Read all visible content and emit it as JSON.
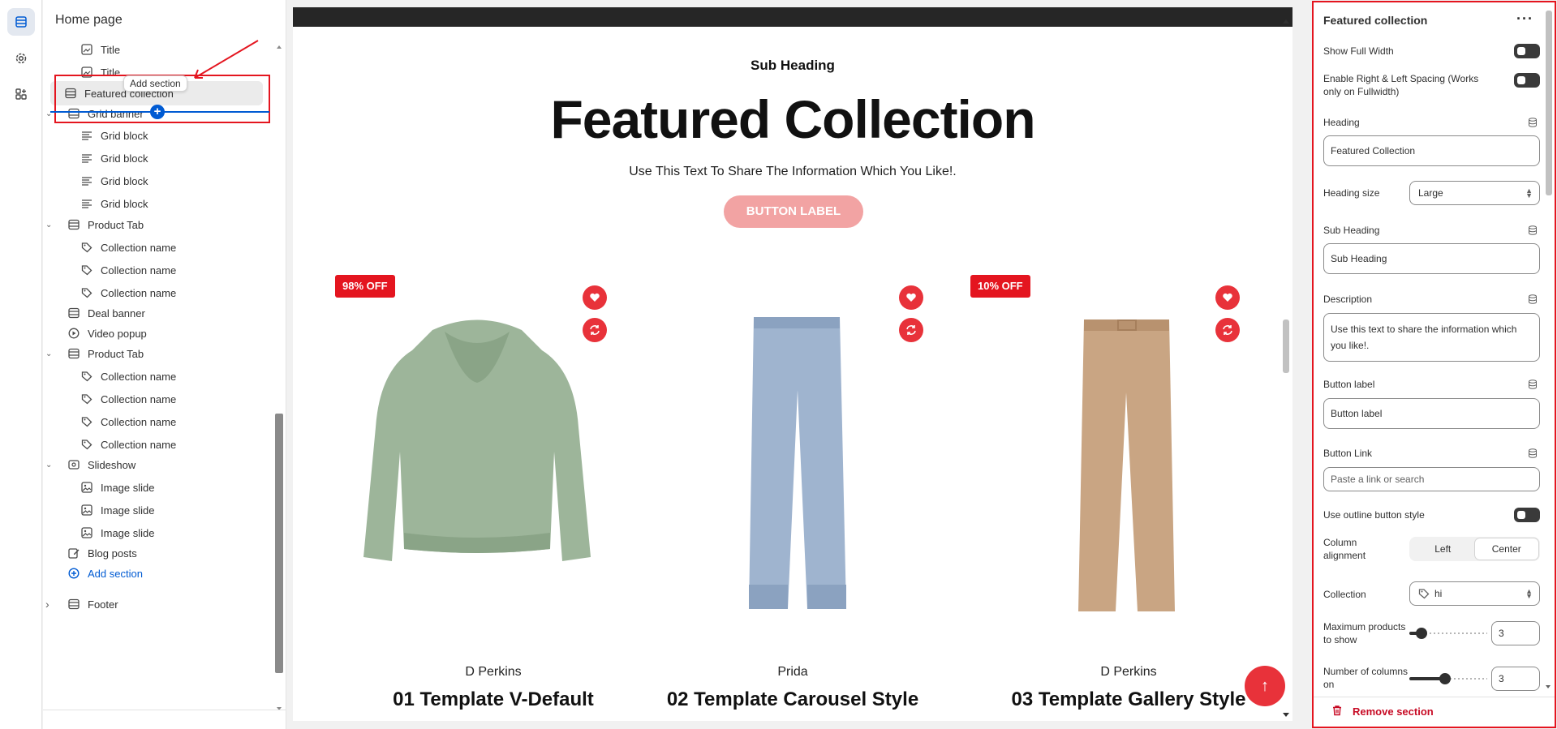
{
  "rail": {
    "items": [
      {
        "icon": "sections-icon",
        "active": true
      },
      {
        "icon": "gear-icon",
        "active": false
      },
      {
        "icon": "apps-icon",
        "active": false
      }
    ]
  },
  "sidebar": {
    "title": "Home page",
    "tooltip": "Add section",
    "nodes": [
      {
        "label": "Title",
        "level": 2,
        "icon": "image-text-icon"
      },
      {
        "label": "Title",
        "level": 2,
        "icon": "image-text-icon"
      },
      {
        "label": "Featured collection",
        "level": 1,
        "icon": "section-icon",
        "selected": true
      },
      {
        "label": "Grid banner",
        "level": 1,
        "icon": "section-icon",
        "expanded": true
      },
      {
        "label": "Grid block",
        "level": 2,
        "icon": "text-icon"
      },
      {
        "label": "Grid block",
        "level": 2,
        "icon": "text-icon"
      },
      {
        "label": "Grid block",
        "level": 2,
        "icon": "text-icon"
      },
      {
        "label": "Grid block",
        "level": 2,
        "icon": "text-icon"
      },
      {
        "label": "Product Tab",
        "level": 1,
        "icon": "section-icon",
        "expanded": true
      },
      {
        "label": "Collection name",
        "level": 2,
        "icon": "tag-icon"
      },
      {
        "label": "Collection name",
        "level": 2,
        "icon": "tag-icon"
      },
      {
        "label": "Collection name",
        "level": 2,
        "icon": "tag-icon"
      },
      {
        "label": "Deal banner",
        "level": 1,
        "icon": "section-icon"
      },
      {
        "label": "Video popup",
        "level": 1,
        "icon": "play-icon"
      },
      {
        "label": "Product Tab",
        "level": 1,
        "icon": "section-icon",
        "expanded": true
      },
      {
        "label": "Collection name",
        "level": 2,
        "icon": "tag-icon"
      },
      {
        "label": "Collection name",
        "level": 2,
        "icon": "tag-icon"
      },
      {
        "label": "Collection name",
        "level": 2,
        "icon": "tag-icon"
      },
      {
        "label": "Collection name",
        "level": 2,
        "icon": "tag-icon"
      },
      {
        "label": "Slideshow",
        "level": 1,
        "icon": "slideshow-icon",
        "expanded": true
      },
      {
        "label": "Image slide",
        "level": 2,
        "icon": "image-icon"
      },
      {
        "label": "Image slide",
        "level": 2,
        "icon": "image-icon"
      },
      {
        "label": "Image slide",
        "level": 2,
        "icon": "image-icon"
      },
      {
        "label": "Blog posts",
        "level": 1,
        "icon": "edit-icon"
      },
      {
        "label": "Add section",
        "level": 1,
        "icon": "plus-circle-icon",
        "add": true
      },
      {
        "label": "Footer",
        "level": 1,
        "icon": "section-icon",
        "collapsed": true
      }
    ]
  },
  "preview": {
    "sub_heading": "Sub Heading",
    "heading": "Featured Collection",
    "description": "Use This Text To Share The Information Which You Like!.",
    "button_label": "BUTTON LABEL",
    "products": [
      {
        "badge": "98% OFF",
        "vendor": "D Perkins",
        "name": "01 Template V-Default",
        "image": "green-hoodie"
      },
      {
        "badge": "",
        "vendor": "Prida",
        "name": "02 Template Carousel Style",
        "image": "blue-jeans"
      },
      {
        "badge": "10% OFF",
        "vendor": "D Perkins",
        "name": "03 Template Gallery Style",
        "image": "tan-trousers"
      }
    ],
    "fab_icon": "arrow-up-icon"
  },
  "panel": {
    "title": "Featured collection",
    "more_icon": "more-icon",
    "show_full_width": {
      "label": "Show Full Width",
      "on": false
    },
    "enable_spacing": {
      "label": "Enable Right & Left Spacing (Works only on Fullwidth)",
      "on": false
    },
    "heading": {
      "label": "Heading",
      "value": "Featured Collection"
    },
    "heading_size": {
      "label": "Heading size",
      "value": "Large"
    },
    "sub_heading": {
      "label": "Sub Heading",
      "value": "Sub Heading"
    },
    "description": {
      "label": "Description",
      "value": "Use this text to share the information which you like!."
    },
    "button_label": {
      "label": "Button label",
      "value": "Button label"
    },
    "button_link": {
      "label": "Button Link",
      "placeholder": "Paste a link or search"
    },
    "outline_button": {
      "label": "Use outline button style",
      "on": false
    },
    "column_alignment": {
      "label": "Column alignment",
      "options": [
        "Left",
        "Center"
      ],
      "selected": "Center"
    },
    "collection": {
      "label": "Collection",
      "value": "hi"
    },
    "max_products": {
      "label": "Maximum products to show",
      "value": "3",
      "fraction": 0.1
    },
    "columns_desktop": {
      "label": "Number of columns on",
      "value": "3",
      "fraction": 0.45
    },
    "remove_label": "Remove section"
  },
  "colors": {
    "accent": "#005bd3",
    "highlight": "#e4151f",
    "sale": "#e8323a",
    "button_pink": "#f2a3a3"
  }
}
